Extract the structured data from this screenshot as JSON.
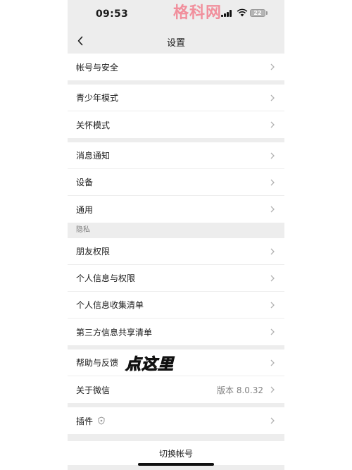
{
  "status_bar": {
    "time": "09:53",
    "battery": "22",
    "watermark": "格科网"
  },
  "nav": {
    "title": "设置",
    "back_icon": "chevron-left-icon"
  },
  "groups": [
    {
      "items": [
        {
          "label": "帐号与安全"
        }
      ]
    },
    {
      "items": [
        {
          "label": "青少年模式"
        },
        {
          "label": "关怀模式"
        }
      ]
    },
    {
      "items": [
        {
          "label": "消息通知"
        },
        {
          "label": "设备"
        },
        {
          "label": "通用"
        }
      ]
    },
    {
      "section_header": "隐私",
      "items": [
        {
          "label": "朋友权限"
        },
        {
          "label": "个人信息与权限"
        },
        {
          "label": "个人信息收集清单"
        },
        {
          "label": "第三方信息共享清单"
        }
      ]
    },
    {
      "items": [
        {
          "label": "帮助与反馈"
        },
        {
          "label": "关于微信",
          "value": "版本 8.0.32"
        }
      ]
    },
    {
      "items": [
        {
          "label": "插件",
          "icon": "shield-icon"
        }
      ]
    }
  ],
  "annotation": "点这里",
  "footer": {
    "switch_account": "切换帐号"
  },
  "colors": {
    "background": "#ededed",
    "card": "#ffffff",
    "annotation": "#f2ea1a",
    "watermark": "#f27f8f"
  }
}
